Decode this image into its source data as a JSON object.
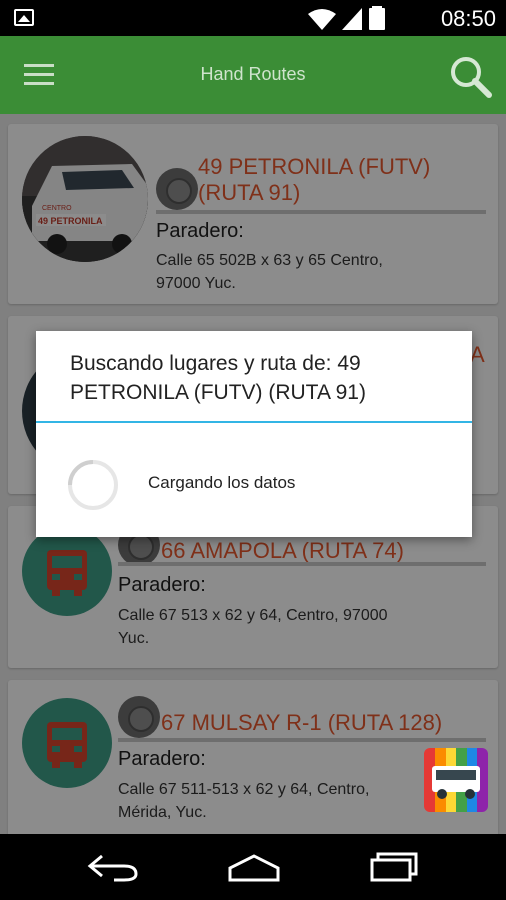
{
  "status_bar": {
    "time": "08:50"
  },
  "app_bar": {
    "title": "Hand Routes"
  },
  "routes": [
    {
      "name_line1": "49 PETRONILA (FUTV)",
      "name_line2": "(RUTA 91)",
      "label": "Paradero:",
      "address_line1": "Calle 65 502B x 63 y 65 Centro,",
      "address_line2": "97000 Yuc.",
      "van_text_1": "CENTRO",
      "van_text_2": "49 PETRONILA"
    },
    {
      "name_line1": "66 AMAPOLA (RUTA 74)",
      "label": "Paradero:",
      "address_line1": "Calle 67 513 x 62 y 64, Centro, 97000",
      "address_line2": "Yuc."
    },
    {
      "name_line1": "67 MULSAY R-1 (RUTA 128)",
      "label": "Paradero:",
      "address_line1": "Calle 67 511-513 x 62 y 64, Centro,",
      "address_line2": "Mérida, Yuc."
    }
  ],
  "hidden_card_name_fragment": "A",
  "dialog": {
    "title": "Buscando lugares y ruta de: 49 PETRONILA (FUTV) (RUTA 91)",
    "message": "Cargando los datos"
  },
  "colors": {
    "app_bar": "#3b8d36",
    "route_name": "#e8582e",
    "dialog_accent": "#33b5e5",
    "bus_circle": "#3e9e88"
  }
}
